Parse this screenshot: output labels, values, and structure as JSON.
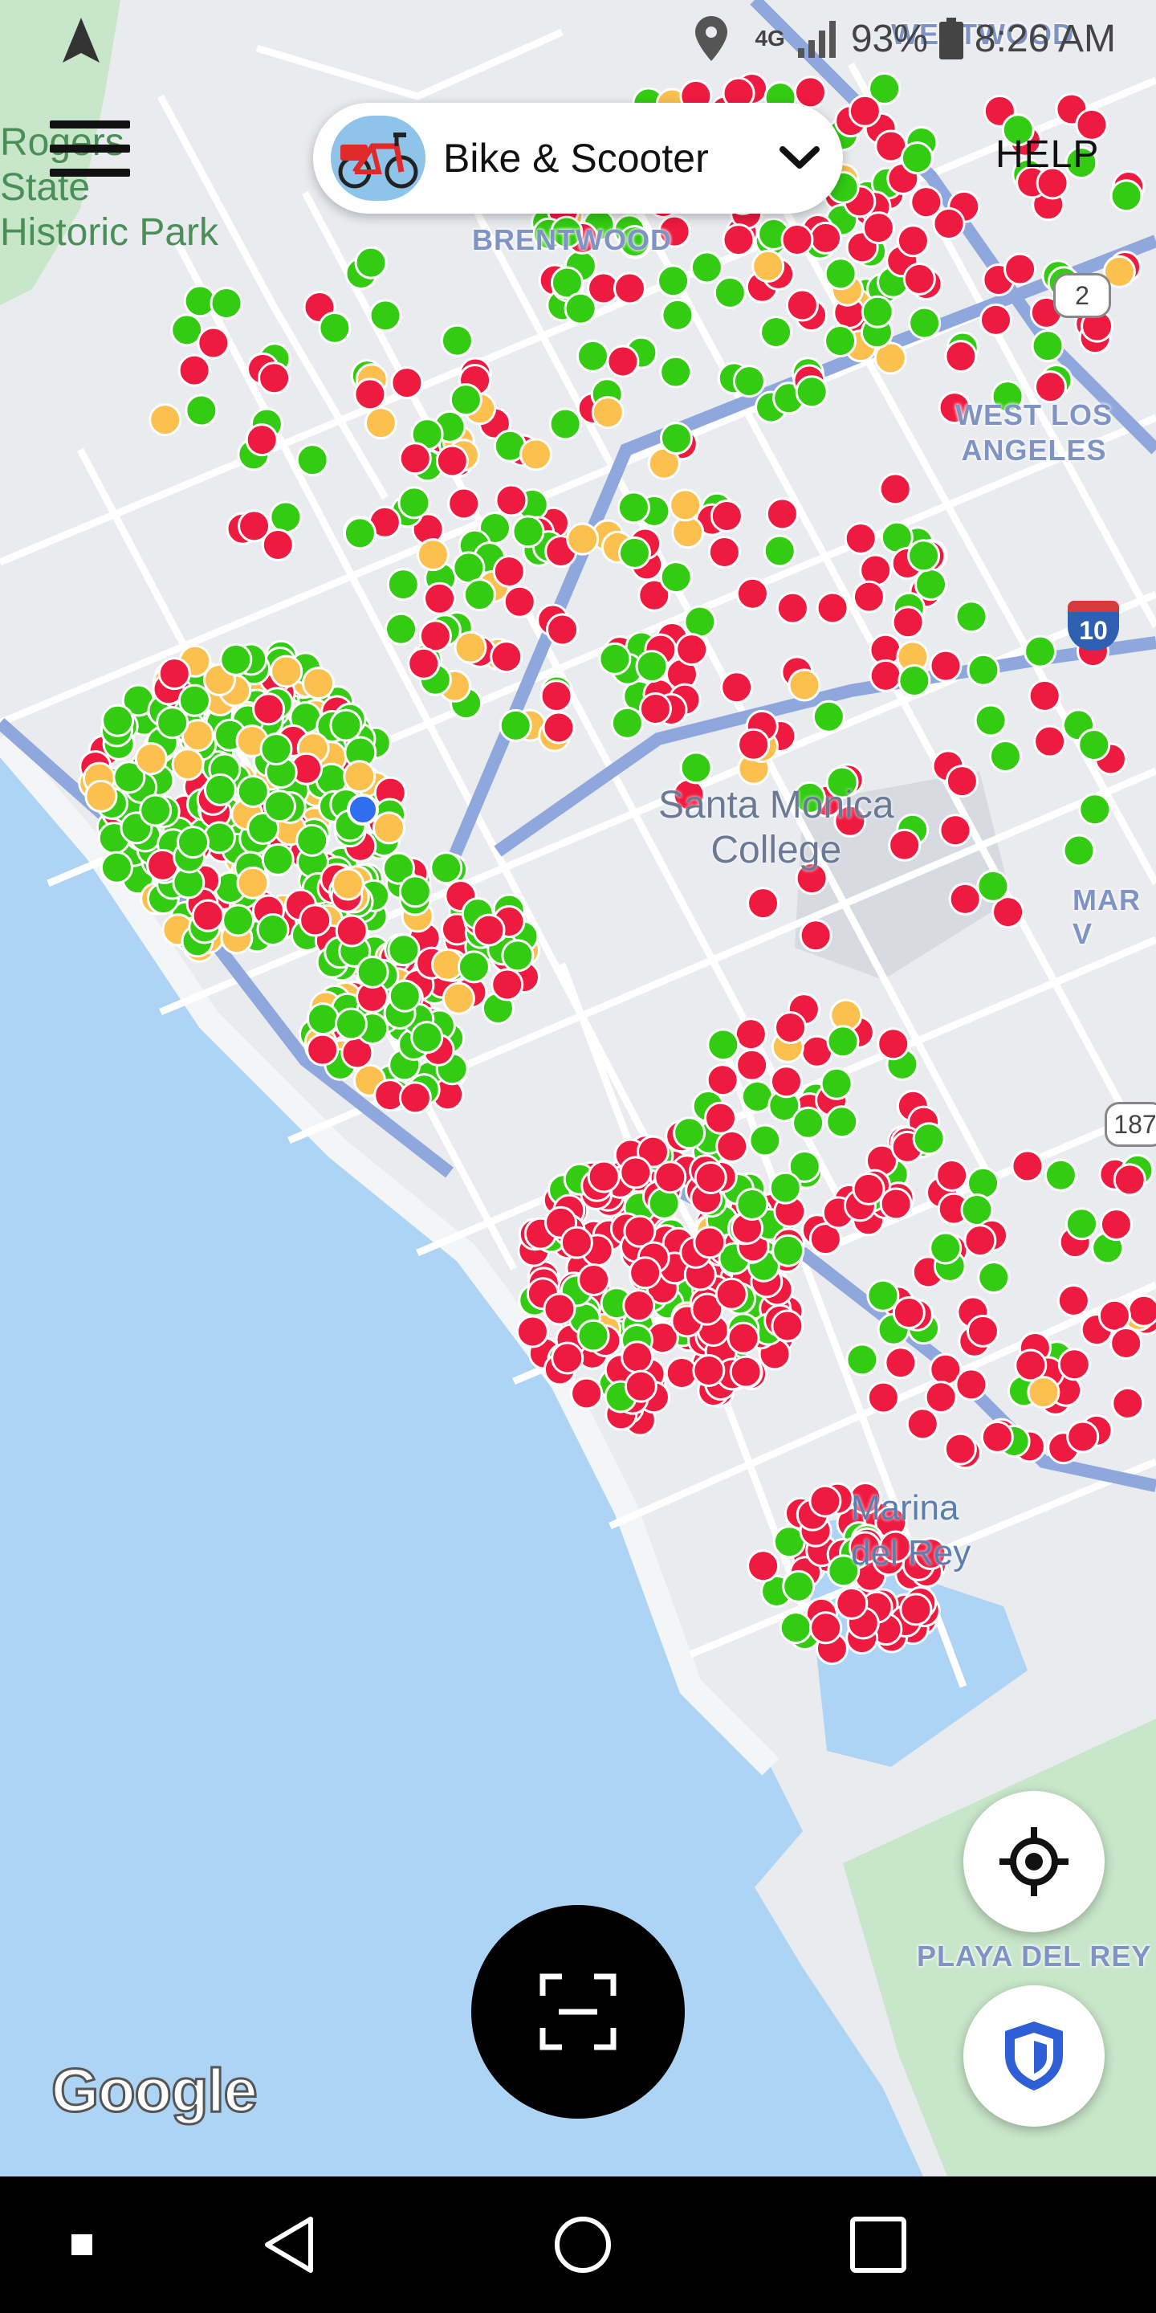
{
  "status_bar": {
    "network": "4G",
    "battery": "93%",
    "time": "8:26 AM"
  },
  "header": {
    "mode_selector_label": "Bike & Scooter",
    "help_label": "HELP"
  },
  "map": {
    "labels": {
      "brentwood": "BRENTWOOD",
      "westwood": "WESTWOOD",
      "west_la_line1": "WEST LOS",
      "west_la_line2": "ANGELES",
      "mar_vista": "MAR V",
      "playa": "PLAYA DEL REY",
      "college_line1": "Santa Monica",
      "college_line2": "College",
      "marina_line1": "Marina",
      "marina_line2": "del Rey",
      "park_line1": "Rogers",
      "park_line2": "State",
      "park_line3": "Historic Park"
    },
    "shields": {
      "route_2": "2",
      "interstate_10": "10",
      "route_187": "187"
    },
    "attribution": "Google",
    "legend_colors": {
      "available": "#33cc12",
      "low_battery": "#fbc04e",
      "unavailable": "#ef1a3f",
      "user_location": "#2f6fef"
    }
  },
  "icons": {
    "menu": "hamburger-menu-icon",
    "bike": "bike-icon",
    "chevron": "chevron-down-icon",
    "recenter": "crosshair-icon",
    "safety": "shield-icon",
    "scan": "scan-icon"
  },
  "colors": {
    "pill_background": "#ffffff",
    "scan_button": "#000000",
    "water": "#aed4f5",
    "land": "#e8eaed",
    "freeway": "#8ea7dc"
  }
}
